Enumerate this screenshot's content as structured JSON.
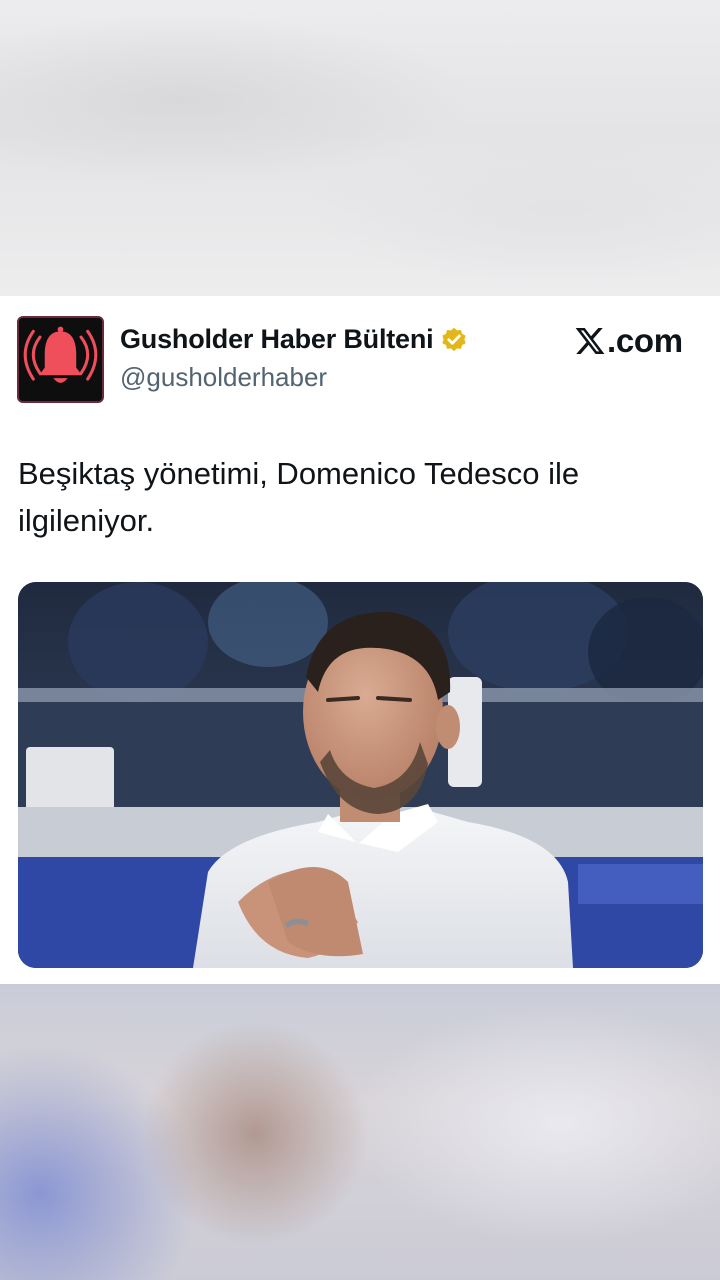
{
  "post": {
    "display_name": "Gusholder Haber Bülteni",
    "handle": "@gusholderhaber",
    "verified": true,
    "source_domain": ".com",
    "text": "Beşiktaş yönetimi, Domenico Tedesco ile ilgileniyor."
  },
  "icons": {
    "avatar": "red-bell-icon",
    "verified": "gold-verified-badge-icon",
    "source": "x-logo-icon"
  },
  "colors": {
    "text_primary": "#0f1419",
    "text_secondary": "#536471",
    "verified_gold": "#e2b719",
    "avatar_bell": "#ef4e5b"
  }
}
